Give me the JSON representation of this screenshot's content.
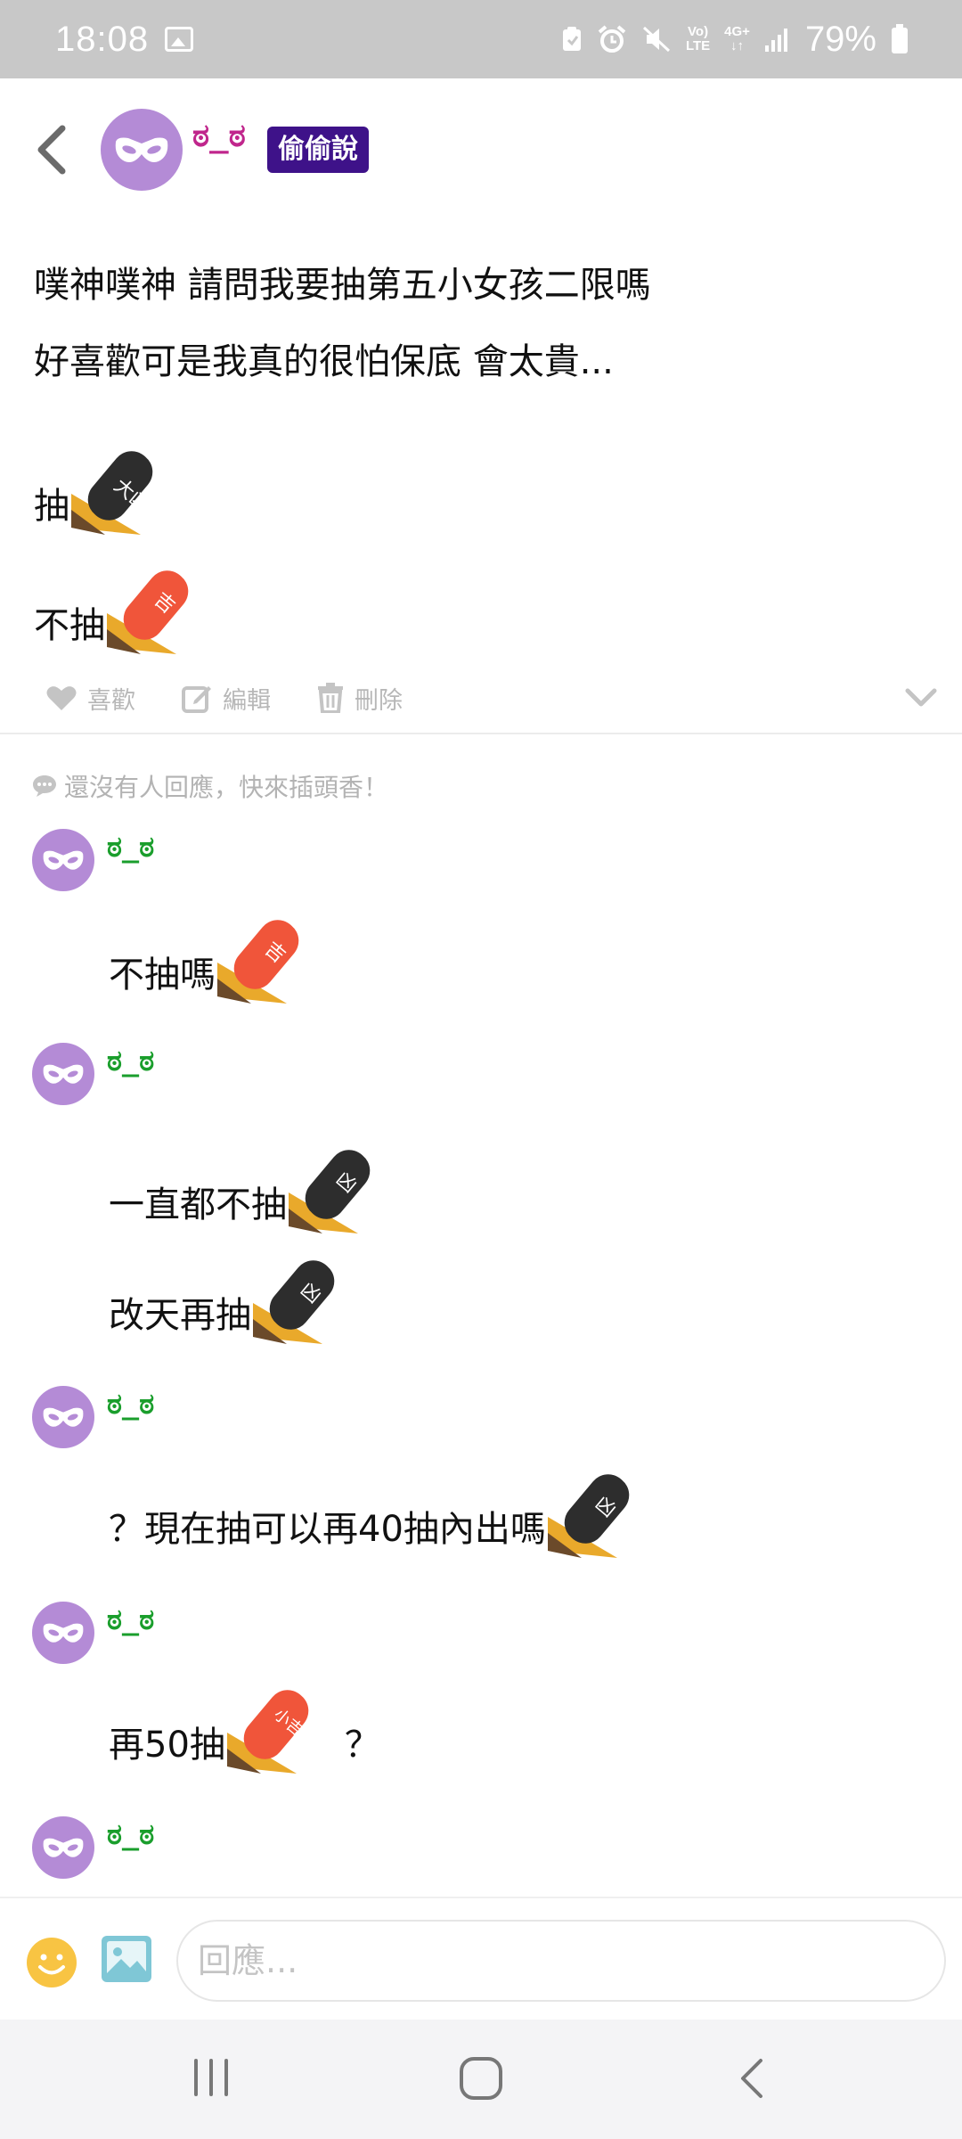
{
  "status_bar": {
    "time": "18:08",
    "battery": "79%",
    "network": "4G+",
    "volte_top": "Vo)",
    "volte_bottom": "LTE"
  },
  "header": {
    "username": "ಠ_ಠ",
    "badge": "偷偷說"
  },
  "post": {
    "line1": "噗神噗神 請問我要抽第五小女孩二限嗎",
    "line2": "好喜歡可是我真的很怕保底 會太貴...",
    "option_draw": "抽",
    "option_nodraw": "不抽",
    "fortune_big_bad": "大凶",
    "fortune_lucky": "吉"
  },
  "actions": {
    "like": "喜歡",
    "edit": "編輯",
    "delete": "刪除"
  },
  "comments_section": {
    "no_reply": "還沒有人回應，快來插頭香！",
    "comments": [
      {
        "user": "ಠ_ಠ",
        "lines": [
          "不抽嗎"
        ],
        "fortunes": [
          "吉"
        ]
      },
      {
        "user": "ಠ_ಠ",
        "lines": [
          "一直都不抽",
          "改天再抽"
        ],
        "fortunes": [
          "凶",
          "凶"
        ]
      },
      {
        "user": "ಠ_ಠ",
        "lines": [
          "？現在抽可以再40抽內出嗎"
        ],
        "fortunes": [
          "凶"
        ]
      },
      {
        "user": "ಠ_ಠ",
        "lines": [
          "再50抽"
        ],
        "suffix": "？",
        "fortunes": [
          "小吉"
        ]
      },
      {
        "user": "ಠ_ಠ",
        "lines": []
      }
    ]
  },
  "reply": {
    "placeholder": "回應..."
  },
  "colors": {
    "badge_bg": "#3e1289",
    "header_username": "#c0268c",
    "comment_username": "#1a9e2c",
    "avatar_bg": "#b48bd6",
    "stick_black": "#2d2d2d",
    "stick_red": "#f0553a",
    "stick_base": "#e9a92b"
  },
  "icons": {
    "back": "chevron-left-icon",
    "avatar": "mask-icon",
    "like": "heart-icon",
    "edit": "edit-icon",
    "delete": "trash-icon",
    "more": "chevron-down-icon",
    "comment": "speech-bubble-icon",
    "emoji": "smiley-icon",
    "image": "image-icon"
  }
}
